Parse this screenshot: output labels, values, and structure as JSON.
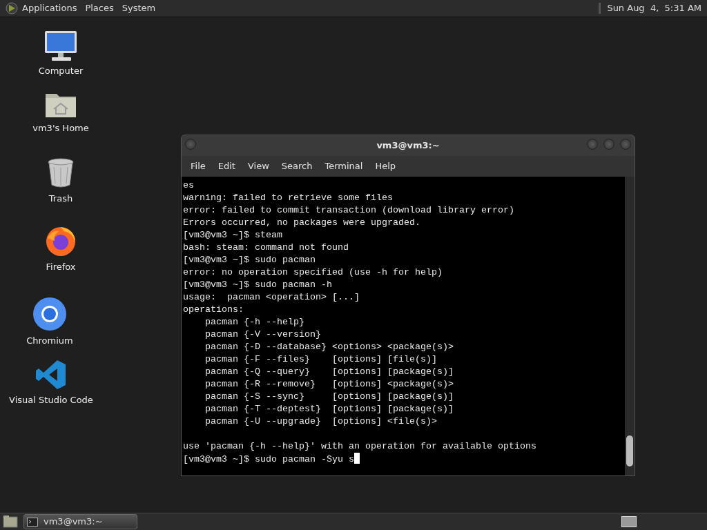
{
  "top_panel": {
    "menus": [
      "Applications",
      "Places",
      "System"
    ],
    "clock": "Sun Aug  4,  5:31 AM"
  },
  "desktop_icons": [
    {
      "label": "Computer",
      "kind": "computer"
    },
    {
      "label": "vm3's Home",
      "kind": "home"
    },
    {
      "label": "Trash",
      "kind": "trash"
    },
    {
      "label": "Firefox",
      "kind": "firefox"
    },
    {
      "label": "Chromium",
      "kind": "chromium"
    },
    {
      "label": "Visual Studio Code",
      "kind": "vscode"
    }
  ],
  "terminal": {
    "title": "vm3@vm3:~",
    "menu": [
      "File",
      "Edit",
      "View",
      "Search",
      "Terminal",
      "Help"
    ],
    "lines": [
      {
        "kind": "text",
        "text": "es"
      },
      {
        "kind": "text",
        "text": "warning: failed to retrieve some files"
      },
      {
        "kind": "text",
        "text": "error: failed to commit transaction (download library error)"
      },
      {
        "kind": "text",
        "text": "Errors occurred, no packages were upgraded."
      },
      {
        "kind": "text",
        "text": "[vm3@vm3 ~]$ steam"
      },
      {
        "kind": "text",
        "text": "bash: steam: command not found"
      },
      {
        "kind": "text",
        "text": "[vm3@vm3 ~]$ sudo pacman"
      },
      {
        "kind": "text",
        "text": "error: no operation specified (use -h for help)"
      },
      {
        "kind": "text",
        "text": "[vm3@vm3 ~]$ sudo pacman -h"
      },
      {
        "kind": "text",
        "text": "usage:  pacman <operation> [...]"
      },
      {
        "kind": "text",
        "text": "operations:"
      },
      {
        "kind": "text",
        "text": "    pacman {-h --help}"
      },
      {
        "kind": "text",
        "text": "    pacman {-V --version}"
      },
      {
        "kind": "text",
        "text": "    pacman {-D --database} <options> <package(s)>"
      },
      {
        "kind": "text",
        "text": "    pacman {-F --files}    [options] [file(s)]"
      },
      {
        "kind": "text",
        "text": "    pacman {-Q --query}    [options] [package(s)]"
      },
      {
        "kind": "text",
        "text": "    pacman {-R --remove}   [options] <package(s)>"
      },
      {
        "kind": "text",
        "text": "    pacman {-S --sync}     [options] [package(s)]"
      },
      {
        "kind": "text",
        "text": "    pacman {-T --deptest}  [options] [package(s)]"
      },
      {
        "kind": "text",
        "text": "    pacman {-U --upgrade}  [options] <file(s)>"
      },
      {
        "kind": "blank"
      },
      {
        "kind": "text",
        "text": "use 'pacman {-h --help}' with an operation for available options"
      },
      {
        "kind": "prompt",
        "text": "[vm3@vm3 ~]$ sudo pacman -Syu s",
        "cursor": true
      }
    ]
  },
  "taskbar": {
    "tasks": [
      {
        "label": "vm3@vm3:~",
        "selected": true
      }
    ]
  }
}
